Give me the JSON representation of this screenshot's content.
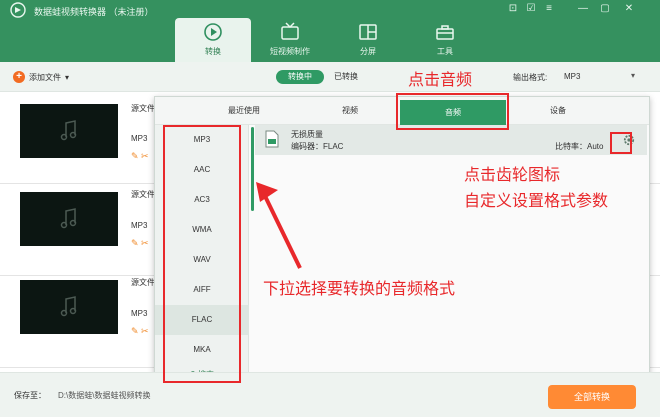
{
  "window": {
    "title": "数据蛙视频转换器 （未注册）",
    "controls": [
      "⊡",
      "☑",
      "≡",
      "—",
      "✕"
    ]
  },
  "nav": {
    "tabs": [
      {
        "label": "转换",
        "active": true
      },
      {
        "label": "短视频制作"
      },
      {
        "label": "分屏"
      },
      {
        "label": "工具"
      }
    ]
  },
  "toolbar": {
    "add_file": "添加文件",
    "converting": "转换中",
    "converted": "已转换",
    "output_format_label": "输出格式:",
    "output_format_value": "MP3"
  },
  "files": [
    {
      "source_label": "源文件",
      "format": "MP3"
    },
    {
      "source_label": "源文件",
      "format": "MP3"
    },
    {
      "source_label": "源文件",
      "format": "MP3"
    }
  ],
  "popup": {
    "tabs": [
      {
        "label": "最近使用"
      },
      {
        "label": "视频"
      },
      {
        "label": "音频",
        "active": true
      },
      {
        "label": "设备"
      }
    ],
    "formats": [
      "MP3",
      "AAC",
      "AC3",
      "WMA",
      "WAV",
      "AIFF",
      "FLAC",
      "MKA"
    ],
    "selected_format": "FLAC",
    "search_label": "搜索",
    "quality": {
      "name": "无损质量",
      "encoder": "编码器：FLAC",
      "bitrate": "比特率：Auto"
    }
  },
  "bottom": {
    "save_to_label": "保存至：",
    "save_path": "D:\\数据蛙\\数据蛙视频转换",
    "convert_all": "全部转换"
  },
  "annotations": {
    "click_audio": "点击音频",
    "click_gear_line1": "点击齿轮图标",
    "click_gear_line2": "自定义设置格式参数",
    "dropdown_select": "下拉选择要转换的音频格式"
  },
  "colors": {
    "brand_green": "#35915f",
    "accent_green": "#2f9a64",
    "annotation_red": "#e8282b",
    "convert_orange": "#ff8a34"
  },
  "icons": {
    "logo": "app-logo",
    "convert": "convert-icon",
    "short_video": "tv-icon",
    "split": "split-screen-icon",
    "tools": "toolbox-icon",
    "gear": "gear-icon",
    "music": "music-note-icon"
  }
}
